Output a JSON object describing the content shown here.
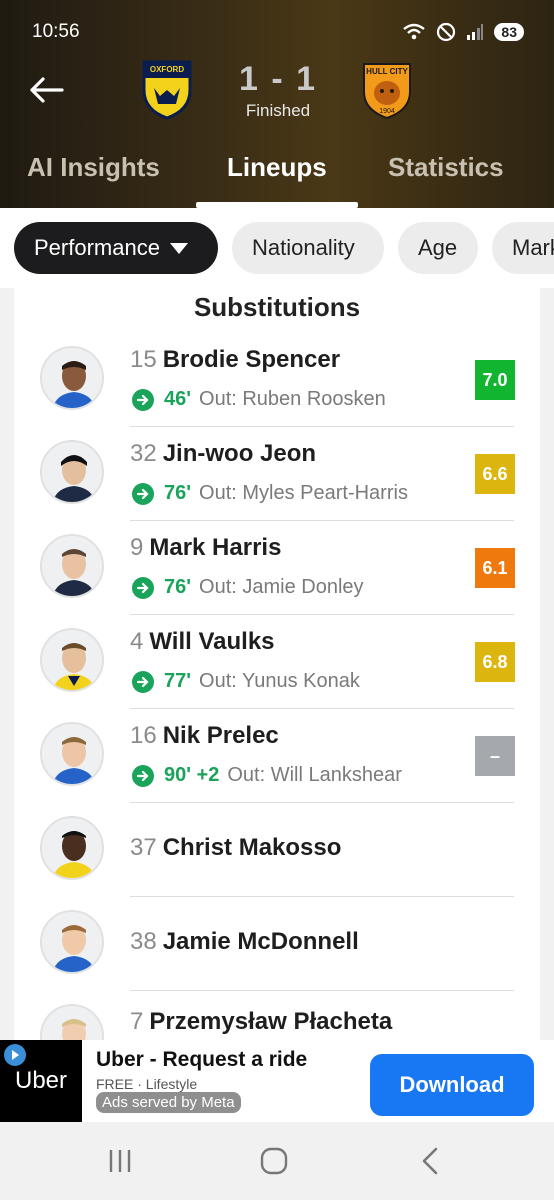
{
  "status_bar": {
    "time": "10:56",
    "battery": "83"
  },
  "match": {
    "home_team": "Oxford United",
    "away_team": "Hull City",
    "score": "1 - 1",
    "status": "Finished"
  },
  "tabs": [
    {
      "label": "AI Insights",
      "active": false
    },
    {
      "label": "Lineups",
      "active": true
    },
    {
      "label": "Statistics",
      "active": false
    }
  ],
  "filters": [
    {
      "label": "Performance",
      "active": true
    },
    {
      "label": "Nationality",
      "active": false
    },
    {
      "label": "Age",
      "active": false
    },
    {
      "label": "Mark",
      "active": false
    }
  ],
  "section_title": "Substitutions",
  "players": [
    {
      "number": "15",
      "name": "Brodie Spencer",
      "minute": "46'",
      "out": "Out: Ruben Roosken",
      "rating": "7.0",
      "rating_color": "#12b530"
    },
    {
      "number": "32",
      "name": "Jin-woo Jeon",
      "minute": "76'",
      "out": "Out: Myles Peart-Harris",
      "rating": "6.6",
      "rating_color": "#dcb50e"
    },
    {
      "number": "9",
      "name": "Mark Harris",
      "minute": "76'",
      "out": "Out: Jamie Donley",
      "rating": "6.1",
      "rating_color": "#f0790e"
    },
    {
      "number": "4",
      "name": "Will Vaulks",
      "minute": "77'",
      "out": "Out: Yunus Konak",
      "rating": "6.8",
      "rating_color": "#dcb50e"
    },
    {
      "number": "16",
      "name": "Nik Prelec",
      "minute": "90' +2",
      "out": "Out: Will Lankshear",
      "rating": "–",
      "rating_color": "#a5a8ad"
    },
    {
      "number": "37",
      "name": "Christ Makosso"
    },
    {
      "number": "38",
      "name": "Jamie McDonnell"
    },
    {
      "number": "7",
      "name": "Przemysław Płacheta"
    }
  ],
  "ad": {
    "brand": "Uber",
    "title": "Uber - Request a ride",
    "subtitle": "FREE · Lifestyle",
    "meta": "Ads served by Meta",
    "button": "Download"
  },
  "colors": {
    "accent_green": "#1aa35a",
    "header_bg": "#3b2e16",
    "ad_button": "#1877f2"
  }
}
